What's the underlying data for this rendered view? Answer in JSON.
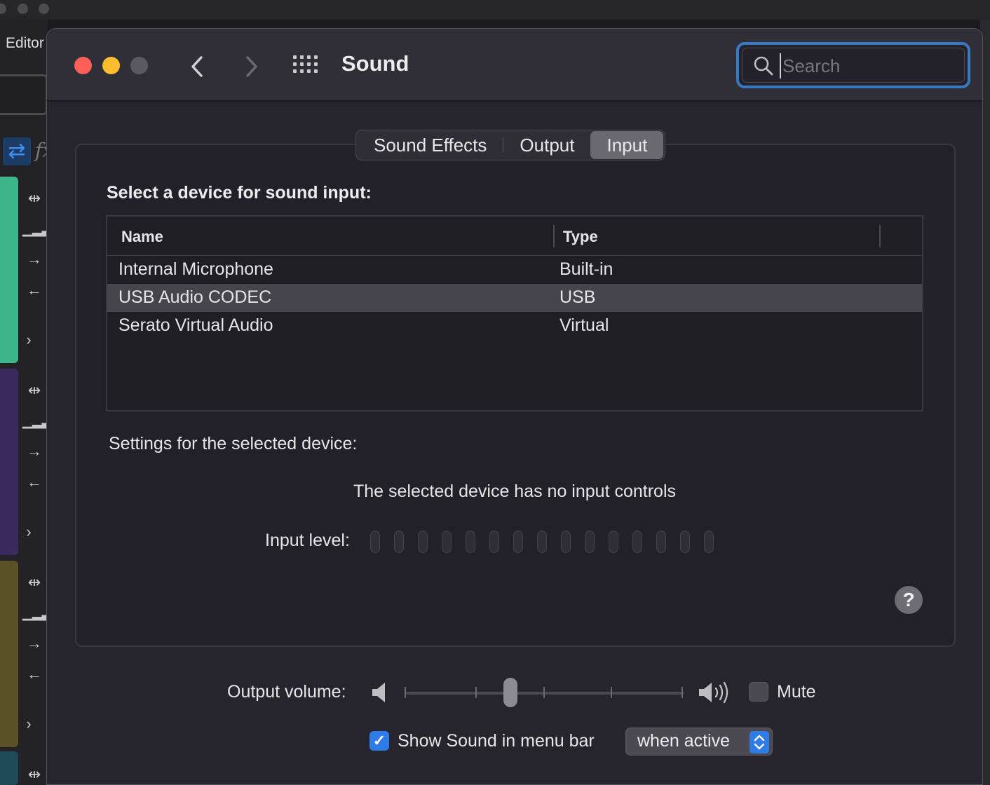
{
  "background_app": {
    "editor_label": "Editor",
    "strip_colors": [
      "#3fb58a",
      "#3b2a5e",
      "#5a5226"
    ]
  },
  "window": {
    "title": "Sound",
    "search": {
      "placeholder": "Search",
      "value": ""
    }
  },
  "tabs": [
    {
      "label": "Sound Effects",
      "active": false
    },
    {
      "label": "Output",
      "active": false
    },
    {
      "label": "Input",
      "active": true
    }
  ],
  "input_section": {
    "heading": "Select a device for sound input:",
    "columns": [
      "Name",
      "Type"
    ],
    "devices": [
      {
        "name": "Internal Microphone",
        "type": "Built-in",
        "selected": false
      },
      {
        "name": "USB Audio CODEC",
        "type": "USB",
        "selected": true
      },
      {
        "name": "Serato Virtual Audio",
        "type": "Virtual",
        "selected": false
      }
    ],
    "settings_label": "Settings for the selected device:",
    "no_controls_text": "The selected device has no input controls",
    "input_level_label": "Input level:",
    "input_level_segments": 15,
    "input_level_lit": 0,
    "help_label": "?"
  },
  "output": {
    "volume_label": "Output volume:",
    "volume_fraction": 0.38,
    "mute_label": "Mute",
    "mute_checked": false,
    "show_in_menu_label": "Show Sound in menu bar",
    "show_in_menu_checked": true,
    "menu_bar_mode": "when active"
  },
  "colors": {
    "accent": "#2f7ce8",
    "focus_ring": "#3a79c0",
    "close": "#fe5f57",
    "minimize": "#febc2e",
    "zoom_disabled": "#5b5a62"
  }
}
